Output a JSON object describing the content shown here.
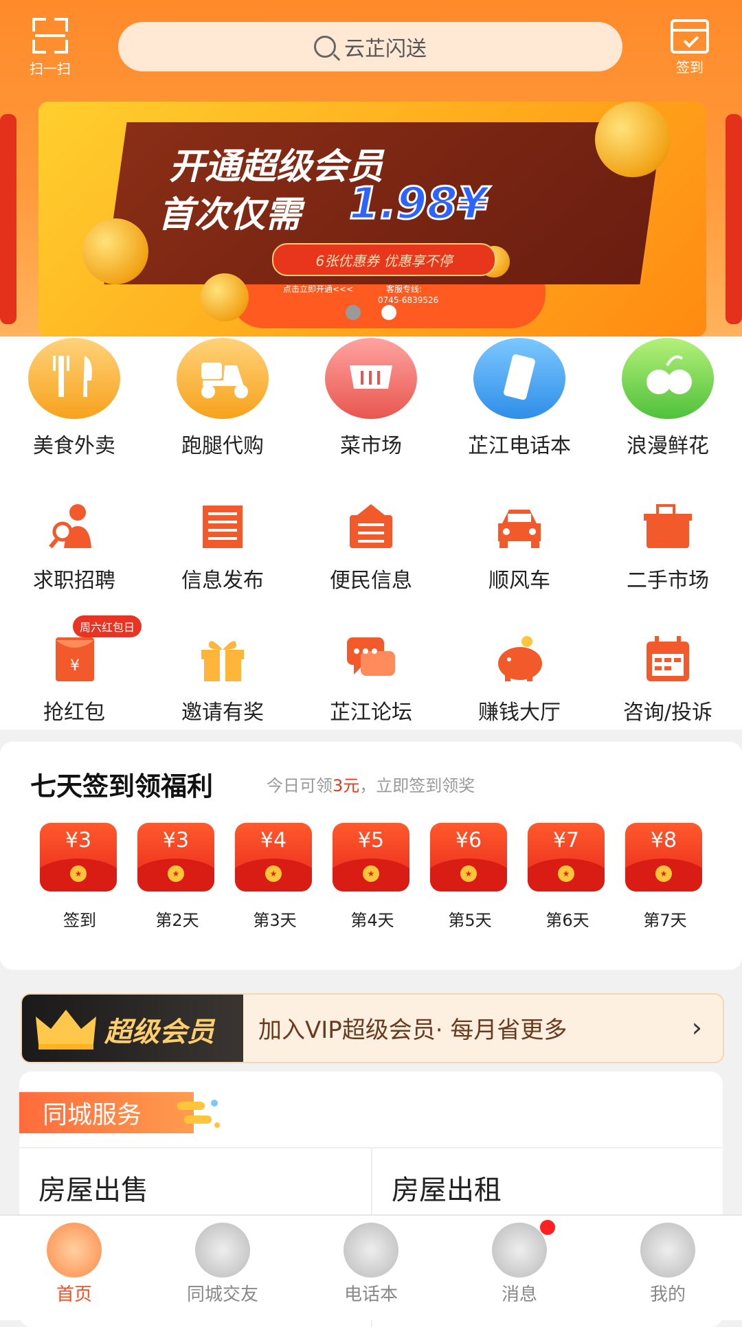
{
  "header": {
    "scan_label": "扫一扫",
    "search_placeholder": "云芷闪送",
    "checkin_label": "签到"
  },
  "banner": {
    "line1": "开通超级会员",
    "line2": "首次仅需",
    "price": "1.98¥",
    "pill": "6张优惠券 优惠享不停",
    "small_left": "点击立即开通<<<",
    "small_right_1": "客服专线:",
    "small_right_2": "0745-6839526",
    "active_slide": 2,
    "slide_count": 2
  },
  "grid": {
    "row1": [
      {
        "label": "美食外卖",
        "icon": "food-fork-knife-icon"
      },
      {
        "label": "跑腿代购",
        "icon": "scooter-icon"
      },
      {
        "label": "菜市场",
        "icon": "shopping-basket-icon"
      },
      {
        "label": "芷江电话本",
        "icon": "phone-icon"
      },
      {
        "label": "浪漫鲜花",
        "icon": "flower-icon"
      }
    ],
    "row2": [
      {
        "label": "求职招聘",
        "icon": "job-search-icon"
      },
      {
        "label": "信息发布",
        "icon": "newspaper-icon"
      },
      {
        "label": "便民信息",
        "icon": "info-board-icon"
      },
      {
        "label": "顺风车",
        "icon": "car-icon"
      },
      {
        "label": "二手市场",
        "icon": "second-hand-box-icon"
      }
    ],
    "row3": [
      {
        "label": "抢红包",
        "icon": "red-packet-icon"
      },
      {
        "label": "邀请有奖",
        "icon": "gift-icon"
      },
      {
        "label": "芷江论坛",
        "icon": "chat-bubbles-icon"
      },
      {
        "label": "赚钱大厅",
        "icon": "piggy-bank-icon"
      },
      {
        "label": "咨询/投诉",
        "icon": "calendar-icon"
      }
    ],
    "saturday_badge": "周六红包日"
  },
  "signin": {
    "title": "七天签到领福利",
    "sub_prefix": "今日可领",
    "sub_amount": "3元",
    "sub_suffix": "，立即签到领奖",
    "days": [
      {
        "amount": "¥3",
        "label": "签到"
      },
      {
        "amount": "¥3",
        "label": "第2天"
      },
      {
        "amount": "¥4",
        "label": "第3天"
      },
      {
        "amount": "¥5",
        "label": "第4天"
      },
      {
        "amount": "¥6",
        "label": "第5天"
      },
      {
        "amount": "¥7",
        "label": "第6天"
      },
      {
        "amount": "¥8",
        "label": "第7天"
      }
    ]
  },
  "vip": {
    "badge": "超级会员",
    "text": "加入VIP超级会员· 每月省更多",
    "chevron": "›"
  },
  "city": {
    "tag": "同城服务",
    "items": [
      "房屋出售",
      "房屋出租"
    ]
  },
  "nav": {
    "items": [
      {
        "label": "首页",
        "icon": "chinese-knot-icon",
        "active": true
      },
      {
        "label": "同城交友",
        "icon": "coin-icon",
        "active": false
      },
      {
        "label": "电话本",
        "icon": "year-2022-icon",
        "active": false
      },
      {
        "label": "消息",
        "icon": "fan-icon",
        "active": false
      },
      {
        "label": "我的",
        "icon": "ancient-coin-icon",
        "active": false
      }
    ]
  },
  "colors": {
    "brand_orange": "#ff8a2a",
    "accent_red": "#e8361d",
    "nav_active": "#ff4a1f"
  }
}
